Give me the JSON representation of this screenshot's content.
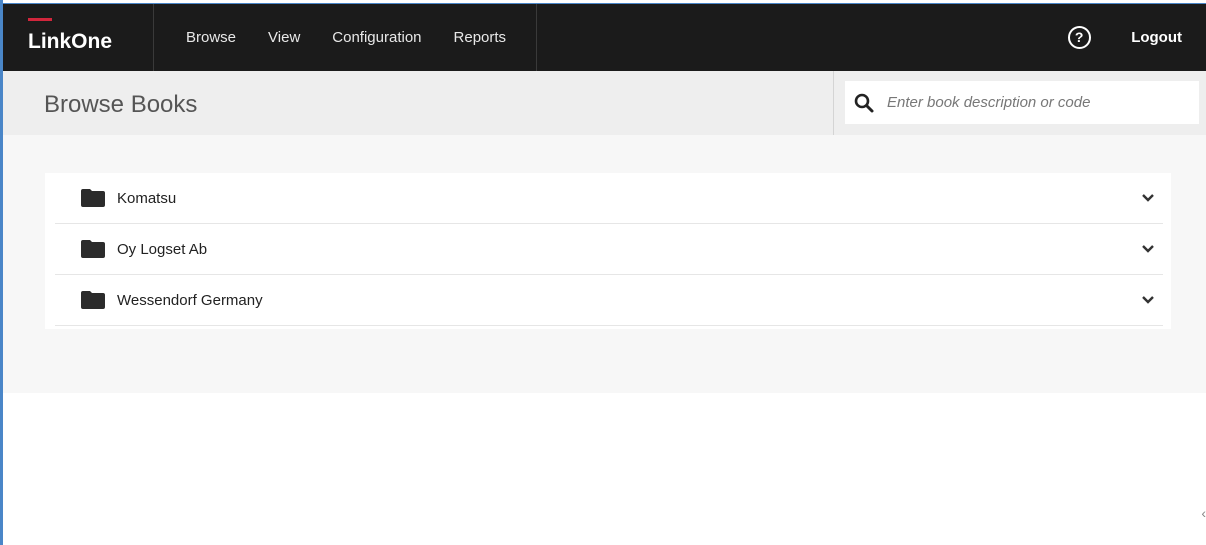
{
  "app": {
    "brand": "LinkOne",
    "brand_accent": "#d1263c",
    "frame_accent": "#4a86c8"
  },
  "nav": {
    "items": [
      {
        "label": "Browse"
      },
      {
        "label": "View"
      },
      {
        "label": "Configuration"
      },
      {
        "label": "Reports"
      }
    ]
  },
  "header_right": {
    "help_icon": "?",
    "logout_label": "Logout"
  },
  "page": {
    "title": "Browse Books"
  },
  "search": {
    "placeholder": "Enter book description or code",
    "value": ""
  },
  "books": [
    {
      "label": "Komatsu",
      "icon": "folder-icon"
    },
    {
      "label": "Oy Logset Ab",
      "icon": "folder-icon"
    },
    {
      "label": "Wessendorf Germany",
      "icon": "folder-icon"
    }
  ],
  "colors": {
    "topbar": "#1b1b1b",
    "subheader": "#eeeeee",
    "content": "#f7f7f7"
  }
}
